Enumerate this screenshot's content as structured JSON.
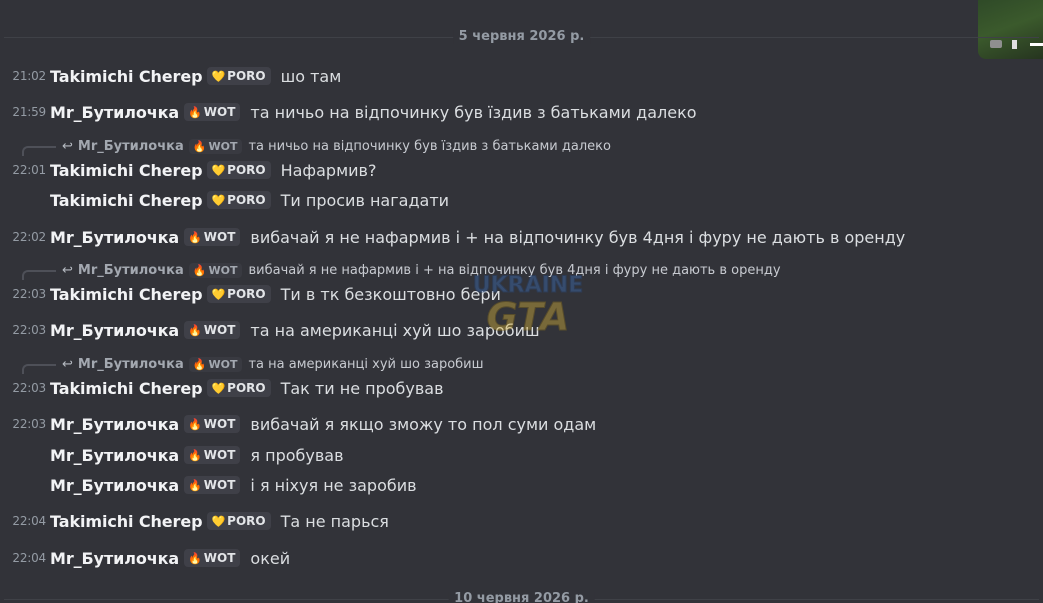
{
  "dividers": {
    "top": "5 червня 2026 р.",
    "bottom": "10 червня 2026 р."
  },
  "thumbnail_icon": "media-thumbnail-icon",
  "roles": {
    "poro": {
      "label": "PORO",
      "icon": "heart-gold-icon",
      "glyph": "💛"
    },
    "wot": {
      "label": "WOT",
      "icon": "flame-icon",
      "glyph": "🔥"
    }
  },
  "users": {
    "taki": "Takimichi Cherep",
    "mr": "Mr_Бутилочка"
  },
  "messages": [
    {
      "time": "21:02",
      "user": "Takimichi Cherep",
      "role": "PORO",
      "text": "шо там"
    },
    {
      "time": "21:59",
      "user": "Mr_Бутилочка",
      "role": "WOT",
      "text": "та ничьо на відпочинку був їздив з батьками далеко"
    },
    {
      "reply_user": "Mr_Бутилочка",
      "reply_role": "WOT",
      "reply_text": "та ничьо на відпочинку був їздив з батьками далеко",
      "time": "22:01",
      "user": "Takimichi Cherep",
      "role": "PORO",
      "text": "Нафармив?"
    },
    {
      "user": "Takimichi Cherep",
      "role": "PORO",
      "text": "Ти просив нагадати"
    },
    {
      "time": "22:02",
      "user": "Mr_Бутилочка",
      "role": "WOT",
      "text": "вибачай я не нафармив і + на відпочинку був 4дня і фуру не дають в оренду"
    },
    {
      "reply_user": "Mr_Бутилочка",
      "reply_role": "WOT",
      "reply_text": "вибачай я не нафармив і + на відпочинку був 4дня і фуру не дають в оренду",
      "time": "22:03",
      "user": "Takimichi Cherep",
      "role": "PORO",
      "text": "Ти в тк безкоштовно бери"
    },
    {
      "time": "22:03",
      "user": "Mr_Бутилочка",
      "role": "WOT",
      "text": "та на американці хуй шо заробиш"
    },
    {
      "reply_user": "Mr_Бутилочка",
      "reply_role": "WOT",
      "reply_text": "та на американці хуй шо заробиш",
      "time": "22:03",
      "user": "Takimichi Cherep",
      "role": "PORO",
      "text": "Так ти не пробував"
    },
    {
      "time": "22:03",
      "user": "Mr_Бутилочка",
      "role": "WOT",
      "text": "вибачай я якщо зможу то пол суми одам"
    },
    {
      "user": "Mr_Бутилочка",
      "role": "WOT",
      "text": "я пробував"
    },
    {
      "user": "Mr_Бутилочка",
      "role": "WOT",
      "text": "і я ніхуя не заробив"
    },
    {
      "time": "22:04",
      "user": "Takimichi Cherep",
      "role": "PORO",
      "text": "Та не парься"
    },
    {
      "time": "22:04",
      "user": "Mr_Бутилочка",
      "role": "WOT",
      "text": "окей"
    }
  ],
  "watermark": {
    "line1": "UKRAINE",
    "line2": "GTA"
  }
}
